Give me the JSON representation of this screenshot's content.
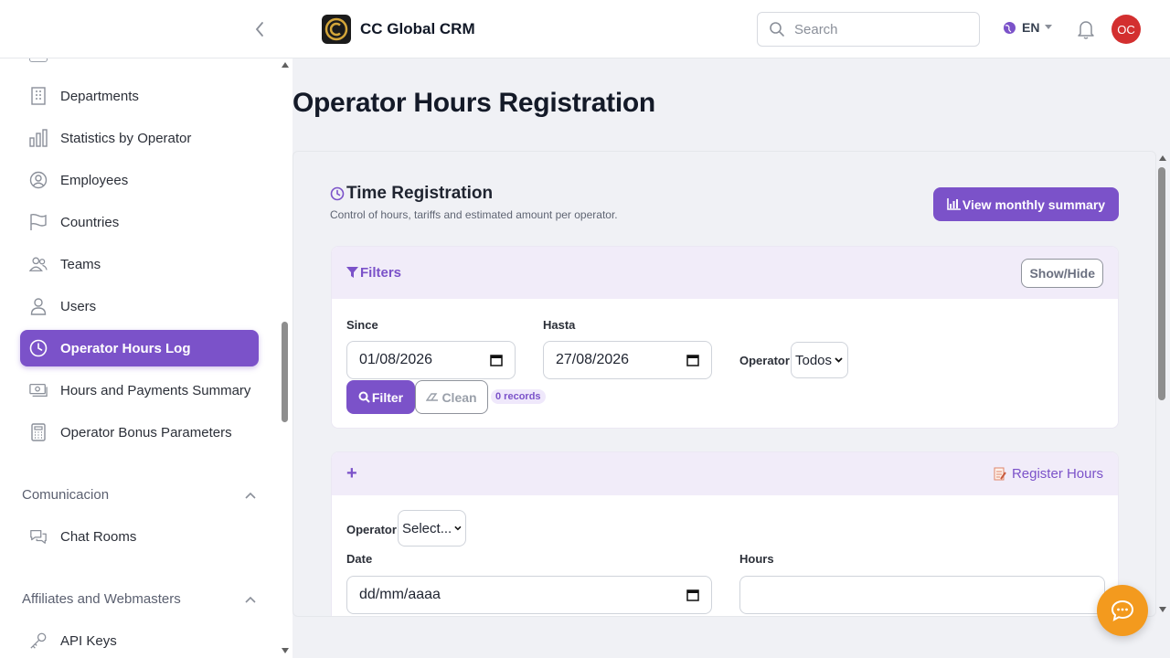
{
  "app": {
    "title": "CC Global CRM",
    "logo_icon": "brand-logo-icon"
  },
  "header": {
    "search_placeholder": "Search",
    "language": "EN",
    "avatar_initials": "OC"
  },
  "sidebar": {
    "items": [
      {
        "label": "Departments",
        "icon": "building-icon",
        "active": false
      },
      {
        "label": "Statistics by Operator",
        "icon": "bar-chart-icon",
        "active": false
      },
      {
        "label": "Employees",
        "icon": "user-circle-icon",
        "active": false
      },
      {
        "label": "Countries",
        "icon": "flag-icon",
        "active": false
      },
      {
        "label": "Teams",
        "icon": "users-icon",
        "active": false
      },
      {
        "label": "Users",
        "icon": "user-icon",
        "active": false
      },
      {
        "label": "Operator Hours Log",
        "icon": "clock-icon",
        "active": true
      },
      {
        "label": "Hours and Payments Summary",
        "icon": "payments-icon",
        "active": false
      },
      {
        "label": "Operator Bonus Parameters",
        "icon": "calculator-icon",
        "active": false
      }
    ],
    "sections": [
      {
        "title": "Comunicacion",
        "items": [
          {
            "label": "Chat Rooms",
            "icon": "chat-icon"
          }
        ]
      },
      {
        "title": "Affiliates and Webmasters",
        "items": [
          {
            "label": "API Keys",
            "icon": "key-icon"
          }
        ]
      }
    ]
  },
  "main": {
    "page_title": "Operator Hours Registration",
    "section_title": "Time Registration",
    "section_subtitle": "Control of hours, tariffs and estimated amount per operator.",
    "monthly_summary_button": "View monthly summary",
    "filters": {
      "title": "Filters",
      "toggle_button": "Show/Hide",
      "since_label": "Since",
      "since_value": "01/08/2026",
      "until_label": "Hasta",
      "until_value": "27/08/2026",
      "operator_label": "Operator",
      "operator_value": "Todos",
      "filter_button": "Filter",
      "clean_button": "Clean",
      "records_badge": "0 records"
    },
    "register": {
      "add_symbol": "+",
      "title": "Register Hours",
      "operator_label": "Operator",
      "operator_value": "Select...",
      "date_label": "Date",
      "date_placeholder": "dd/mm/aaaa",
      "hours_label": "Hours",
      "hours_value": ""
    }
  },
  "colors": {
    "accent": "#7b52c9",
    "avatar": "#d32f2f",
    "fab": "#f39a1e"
  }
}
